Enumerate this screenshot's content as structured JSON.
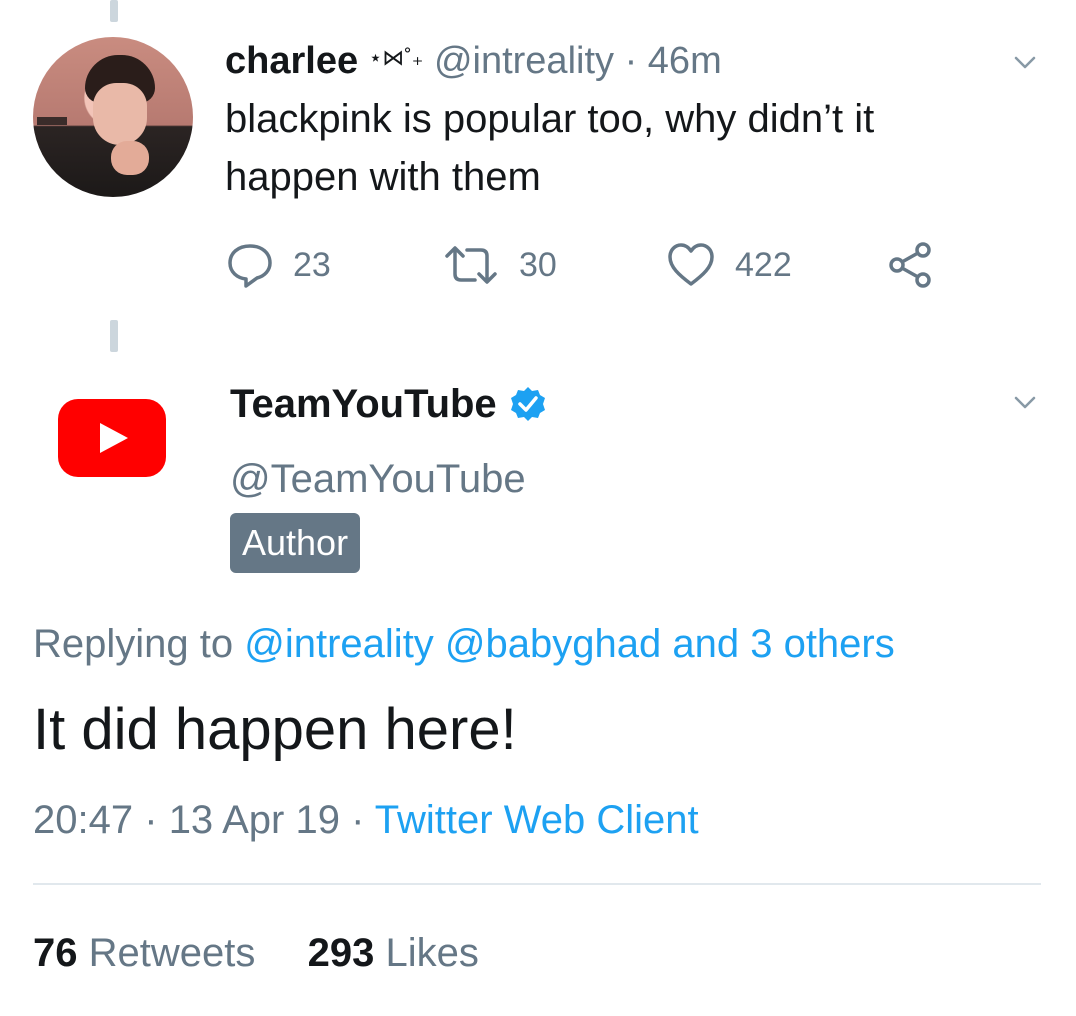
{
  "tweet1": {
    "display_name": "charlee",
    "name_decoration": "⋆⋈˚₊",
    "handle": "@intreality",
    "separator": "·",
    "time_ago": "46m",
    "text": "blackpink is popular too, why didn’t it happen with them",
    "actions": {
      "replies": "23",
      "retweets": "30",
      "likes": "422"
    },
    "icons": {
      "reply": "reply-icon",
      "retweet": "retweet-icon",
      "like": "heart-icon",
      "share": "share-icon",
      "menu": "chevron-down-icon"
    }
  },
  "tweet2": {
    "display_name": "TeamYouTube",
    "verified": true,
    "handle": "@TeamYouTube",
    "badge": "Author",
    "replying_prefix": "Replying to",
    "replying_users": "@intreality @babyghad and 3 others",
    "text": "It did happen here!",
    "time": "20:47",
    "date": "13 Apr 19",
    "separator": "·",
    "source": "Twitter Web Client",
    "retweets_count": "76",
    "retweets_label": "Retweets",
    "likes_count": "293",
    "likes_label": "Likes"
  },
  "colors": {
    "link": "#1da1f2",
    "muted": "#657786",
    "youtube_red": "#ff0000",
    "verified_blue": "#1da1f2",
    "badge_bg": "#657786"
  }
}
